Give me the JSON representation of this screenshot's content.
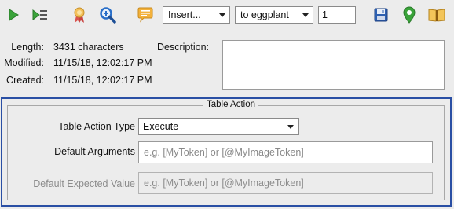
{
  "toolbar": {
    "icons": [
      {
        "name": "run-icon",
        "color": "#3aa33a"
      },
      {
        "name": "run-selection-icon",
        "color": "#3aa33a"
      },
      {
        "name": "ribbon-award-icon",
        "color": "#e8a13a"
      },
      {
        "name": "zoom-search-icon",
        "color": "#2a6fc9"
      },
      {
        "name": "comment-icon",
        "color": "#f0a830"
      },
      {
        "name": "save-icon",
        "color": "#2d5fb0"
      },
      {
        "name": "location-pin-icon",
        "color": "#3aa33a"
      },
      {
        "name": "book-icon",
        "color": "#e8b13a"
      }
    ],
    "insert_select": "Insert...",
    "target_select": "to eggplant",
    "count_value": "1"
  },
  "info": {
    "length_label": "Length:",
    "length_value": "3431 characters",
    "modified_label": "Modified:",
    "modified_value": "11/15/18, 12:02:17 PM",
    "created_label": "Created:",
    "created_value": "11/15/18, 12:02:17 PM",
    "description_label": "Description:",
    "description_value": ""
  },
  "table_action": {
    "title": "Table Action",
    "type_label": "Table Action Type",
    "type_value": "Execute",
    "args_label": "Default Arguments",
    "args_placeholder": "e.g. [MyToken] or [@MyImageToken]",
    "expected_label": "Default Expected Value",
    "expected_placeholder": "e.g. [MyToken] or [@MyImageToken]"
  },
  "colors": {
    "panel_border": "#2a4fa4",
    "background": "#ececec"
  }
}
